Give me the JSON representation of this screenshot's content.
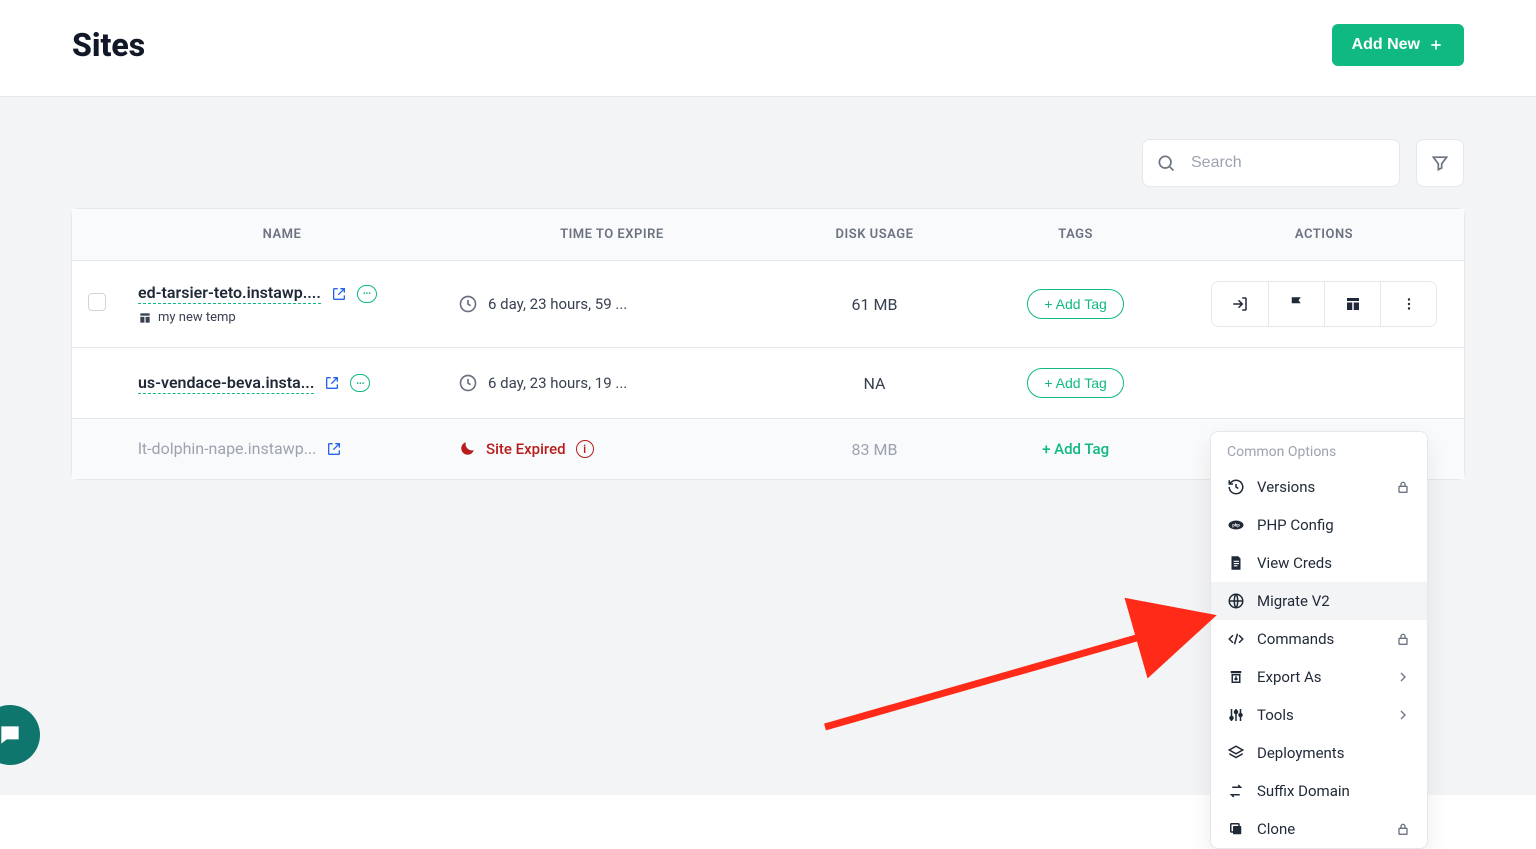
{
  "header": {
    "title": "Sites",
    "add_button": "Add New"
  },
  "toolbar": {
    "search_placeholder": "Search"
  },
  "columns": {
    "name": "NAME",
    "time": "TIME TO EXPIRE",
    "disk": "DISK USAGE",
    "tags": "TAGS",
    "actions": "ACTIONS"
  },
  "rows": [
    {
      "name": "ed-tarsier-teto.instawp....",
      "sub": "my new temp",
      "time": "6 day, 23 hours, 59 ...",
      "disk": "61 MB",
      "tag_label": "+ Add Tag",
      "show_actions": true,
      "show_checkbox": true,
      "show_sub": true,
      "expired": false
    },
    {
      "name": "us-vendace-beva.insta...",
      "sub": "",
      "time": "6 day, 23 hours, 19 ...",
      "disk": "NA",
      "tag_label": "+ Add Tag",
      "show_actions": false,
      "show_checkbox": false,
      "show_sub": false,
      "expired": false
    },
    {
      "name": "lt-dolphin-nape.instawp...",
      "sub": "",
      "time_expired": "Site Expired",
      "disk": "83 MB",
      "tag_label": "+ Add Tag",
      "show_actions": false,
      "show_checkbox": false,
      "show_sub": false,
      "expired": true
    }
  ],
  "menu": {
    "header": "Common Options",
    "items": [
      {
        "label": "Versions",
        "icon": "history",
        "lock": true
      },
      {
        "label": "PHP Config",
        "icon": "php"
      },
      {
        "label": "View Creds",
        "icon": "doc"
      },
      {
        "label": "Migrate V2",
        "icon": "globe",
        "highlight": true
      },
      {
        "label": "Commands",
        "icon": "code",
        "lock": true
      },
      {
        "label": "Export As",
        "icon": "export",
        "chevron": true
      },
      {
        "label": "Tools",
        "icon": "sliders",
        "chevron": true
      },
      {
        "label": "Deployments",
        "icon": "deploy"
      },
      {
        "label": "Suffix Domain",
        "icon": "swap"
      },
      {
        "label": "Clone",
        "icon": "copy",
        "lock": true
      }
    ]
  }
}
